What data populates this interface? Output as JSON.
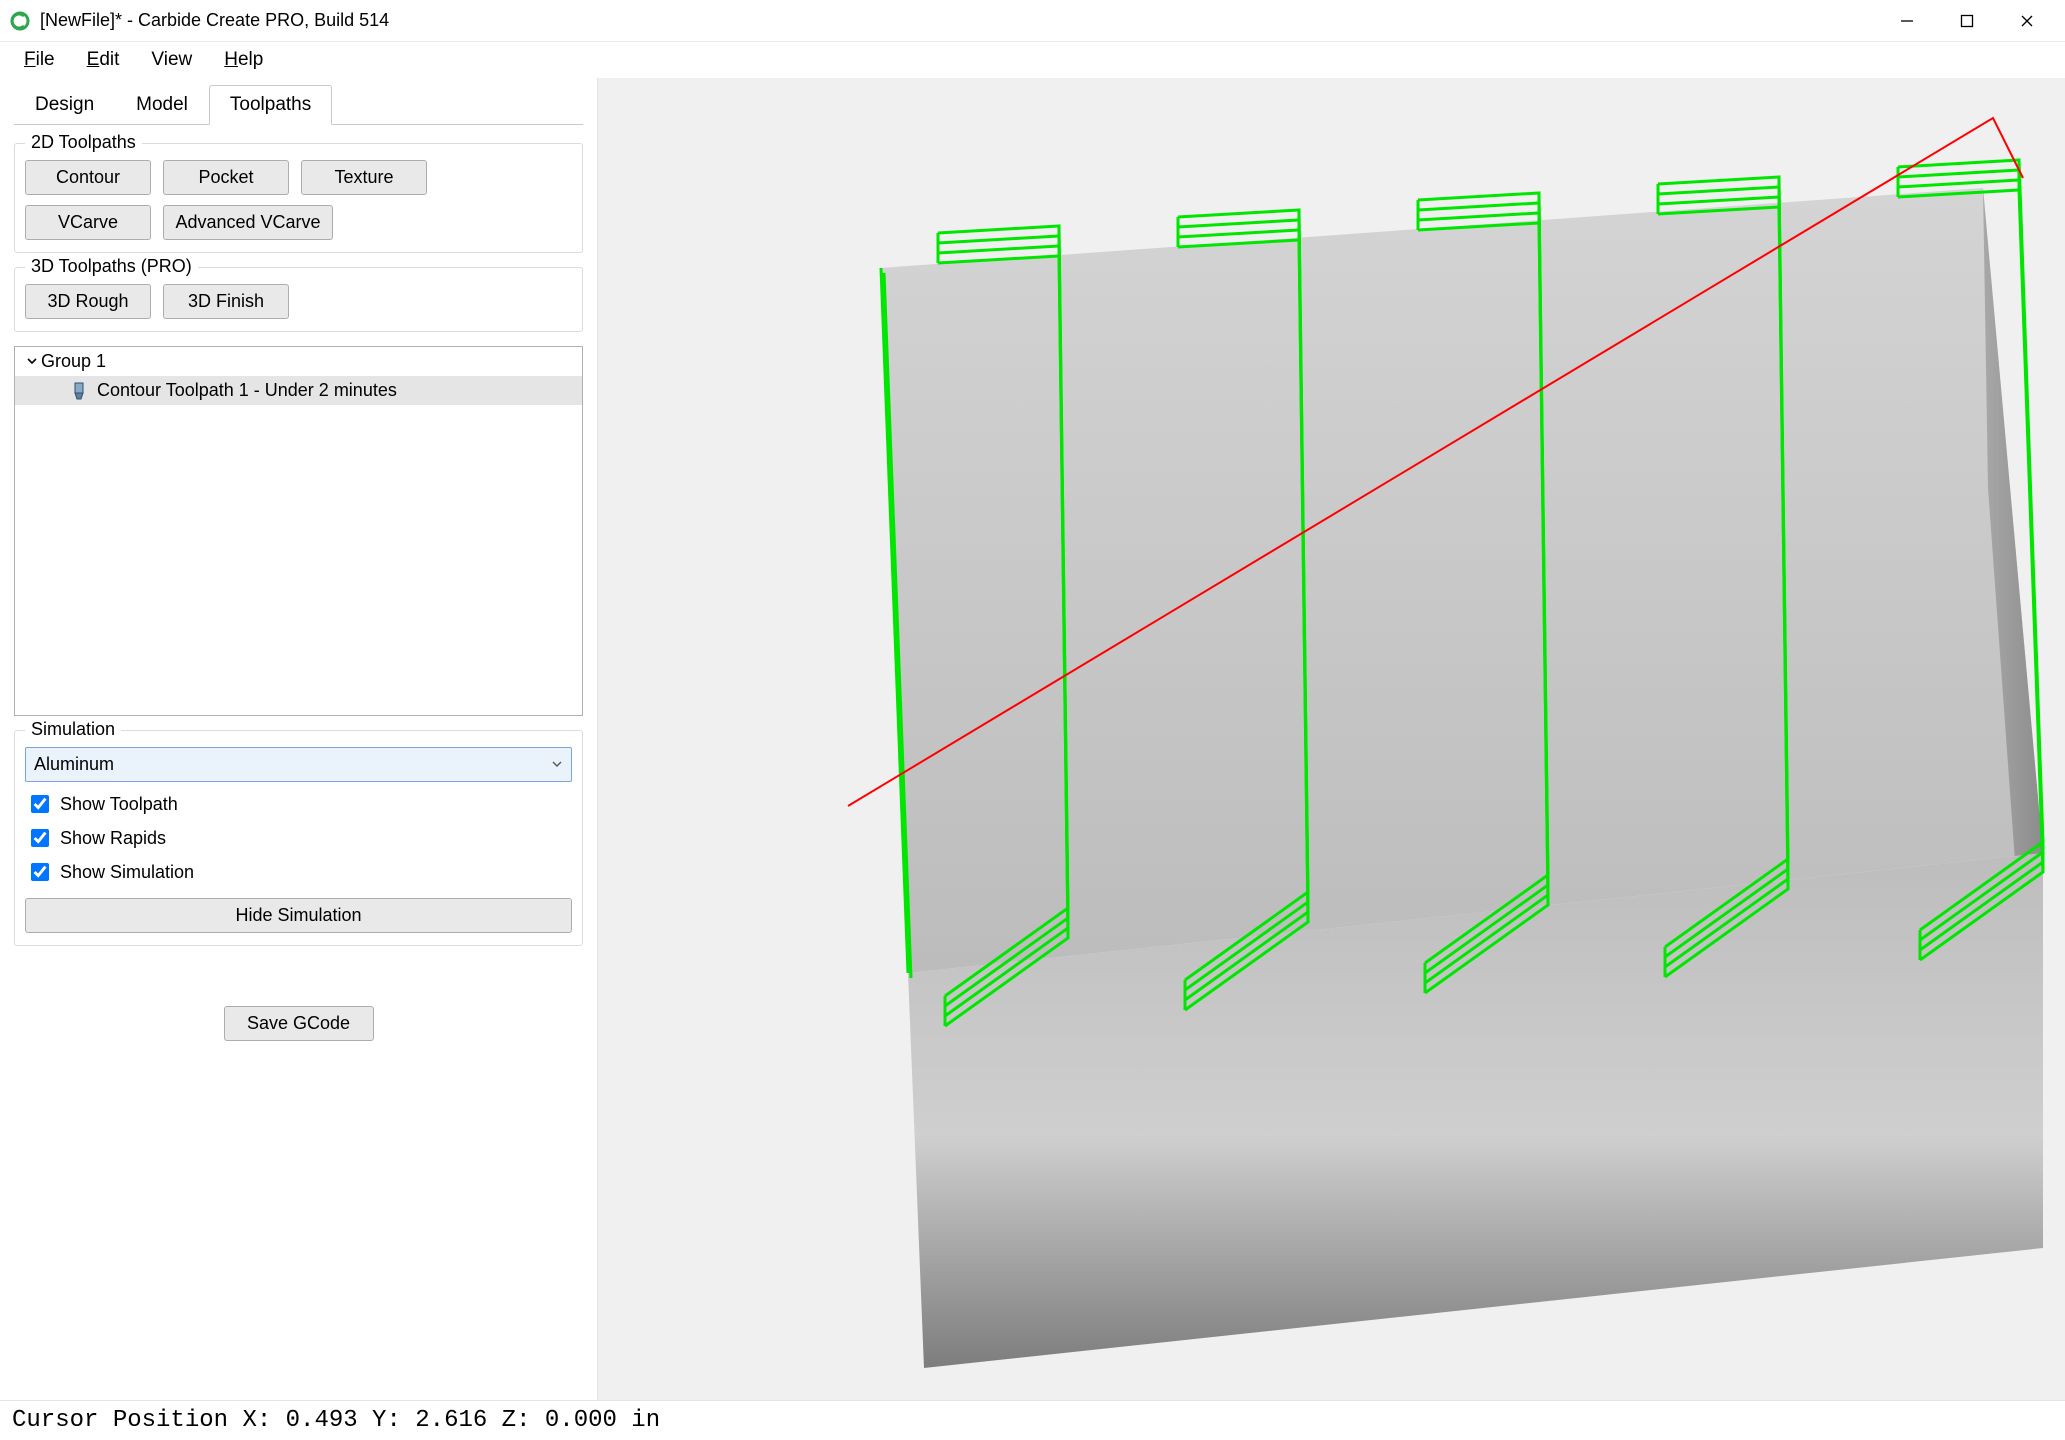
{
  "window": {
    "title": "[NewFile]* - Carbide Create PRO, Build 514"
  },
  "menu": {
    "file": "File",
    "edit": "Edit",
    "view": "View",
    "help": "Help"
  },
  "tabs": {
    "design": "Design",
    "model": "Model",
    "toolpaths": "Toolpaths",
    "active": "toolpaths"
  },
  "groups": {
    "g2d": {
      "legend": "2D Toolpaths",
      "contour": "Contour",
      "pocket": "Pocket",
      "texture": "Texture",
      "vcarve": "VCarve",
      "adv_vcarve": "Advanced VCarve"
    },
    "g3d": {
      "legend": "3D Toolpaths (PRO)",
      "rough": "3D Rough",
      "finish": "3D Finish"
    }
  },
  "tree": {
    "group1": "Group 1",
    "item1": "Contour Toolpath 1 - Under 2 minutes"
  },
  "simulation": {
    "legend": "Simulation",
    "material": "Aluminum",
    "show_tp": "Show Toolpath",
    "show_rapids": "Show Rapids",
    "show_sim": "Show Simulation",
    "hide_btn": "Hide Simulation",
    "show_tp_checked": true,
    "show_rapids_checked": true,
    "show_sim_checked": true
  },
  "save_gcode": "Save GCode",
  "status": {
    "label": "Cursor Position",
    "x": "0.493",
    "y": "2.616",
    "z": "0.000",
    "units": "in"
  },
  "colors": {
    "toolpath": "#00e600",
    "rapid": "#ff0000",
    "stock_light": "#d8d8d8",
    "stock_dark": "#9e9e9e"
  }
}
